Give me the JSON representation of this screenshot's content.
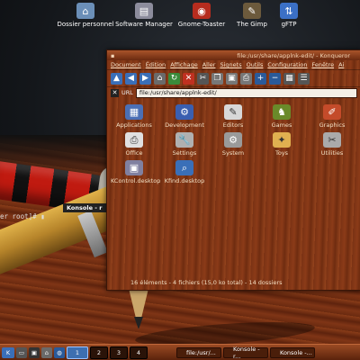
{
  "desktop_icons": [
    {
      "label": "Dossier personnel",
      "icon": "home-folder-icon",
      "color": "#6b8fb8"
    },
    {
      "label": "Software Manager",
      "icon": "software-manager-icon",
      "color": "#8c8c9c"
    },
    {
      "label": "Gnome-Toaster",
      "icon": "toaster-icon",
      "color": "#b62c1e"
    },
    {
      "label": "The Gimp",
      "icon": "gimp-icon",
      "color": "#6c5a3c"
    },
    {
      "label": "gFTP",
      "icon": "ftp-icon",
      "color": "#3b70c6"
    }
  ],
  "konsole": {
    "title": "Konsole - r",
    "prompt": "er root]# "
  },
  "window": {
    "title": "file:/usr/share/applnk-edit/ - Konqueror",
    "menu": [
      "Document",
      "Édition",
      "Affichage",
      "Aller",
      "Signets",
      "Outils",
      "Configuration",
      "Fenêtre",
      "Ai"
    ],
    "location_label": "URL",
    "location_value": "file:/usr/share/applnk-edit/",
    "items": [
      {
        "name": "Applications",
        "icon": "applications-icon",
        "color": "#4b6fb5"
      },
      {
        "name": "Development",
        "icon": "development-icon",
        "color": "#3a5fb0"
      },
      {
        "name": "Editors",
        "icon": "editors-icon",
        "color": "#d8d8d8"
      },
      {
        "name": "Games",
        "icon": "games-icon",
        "color": "#6a8a2a"
      },
      {
        "name": "Graphics",
        "icon": "graphics-icon",
        "color": "#c44b2a"
      },
      {
        "name": "Office",
        "icon": "office-icon",
        "color": "#e0e0e0"
      },
      {
        "name": "Settings",
        "icon": "settings-icon",
        "color": "#b0b0b0"
      },
      {
        "name": "System",
        "icon": "system-icon",
        "color": "#9a9a9a"
      },
      {
        "name": "Toys",
        "icon": "toys-icon",
        "color": "#e0b050"
      },
      {
        "name": "Utilities",
        "icon": "utilities-icon",
        "color": "#aaaaaa"
      },
      {
        "name": "KControl.desktop",
        "icon": "kcontrol-icon",
        "color": "#8080a0"
      },
      {
        "name": "Kfind.desktop",
        "icon": "kfind-icon",
        "color": "#3a6fb8"
      }
    ],
    "status": "16 éléments - 4 fichiers (15,0 ko total) - 14 dossiers"
  },
  "taskbar": {
    "pager": [
      "1",
      "2",
      "3",
      "4"
    ],
    "tasks": [
      "file:/usr/...",
      "Konsole - r...",
      "Konsole -..."
    ]
  }
}
